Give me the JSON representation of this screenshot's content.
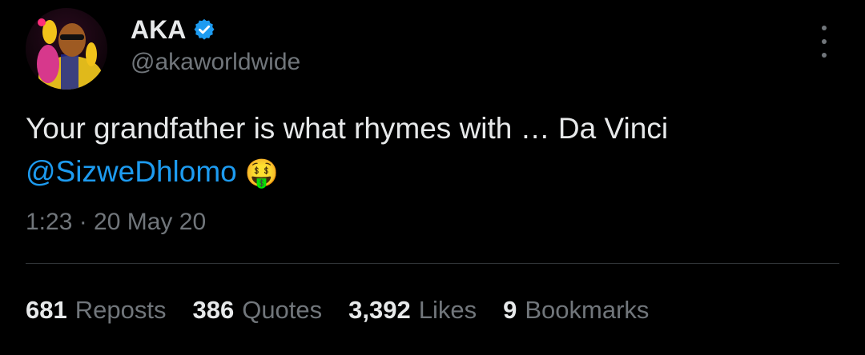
{
  "author": {
    "display_name": "AKA",
    "handle": "@akaworldwide",
    "verified": true,
    "avatar": "avatar-photo"
  },
  "tweet": {
    "text": "Your grandfather is what rhymes with … Da Vinci",
    "mention": "@SizweDhlomo",
    "emoji": "🤑",
    "timestamp": "1:23 · 20 May 20"
  },
  "stats": [
    {
      "count": "681",
      "label": "Reposts"
    },
    {
      "count": "386",
      "label": "Quotes"
    },
    {
      "count": "3,392",
      "label": "Likes"
    },
    {
      "count": "9",
      "label": "Bookmarks"
    }
  ],
  "icons": {
    "verified": "verified-badge-icon",
    "more": "more-options-icon"
  },
  "colors": {
    "background": "#000000",
    "text_primary": "#e7e9ea",
    "text_secondary": "#71767b",
    "link": "#1d9bf0",
    "verified_badge": "#1d9bf0",
    "divider": "#2f3336"
  }
}
